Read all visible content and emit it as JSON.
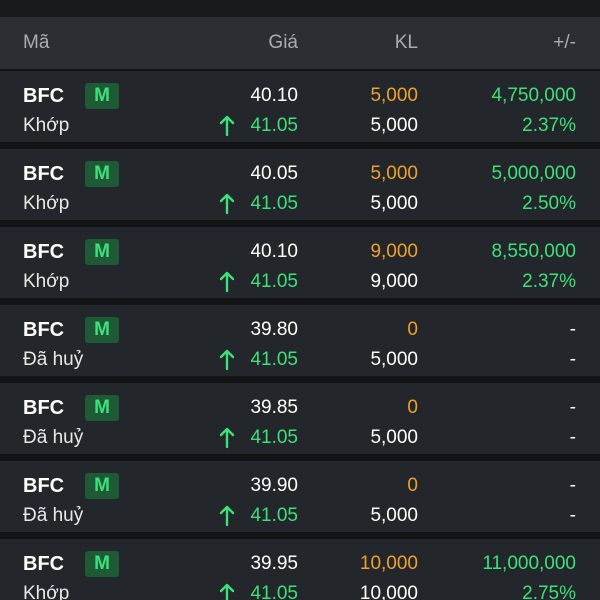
{
  "header": {
    "col_symbol": "Mã",
    "col_price": "Giá",
    "col_volume": "KL",
    "col_change": "+/-"
  },
  "colors": {
    "accent_green": "#3ee07a",
    "accent_orange": "#f0a12a",
    "badge_bg": "#1f5a37",
    "row_bg": "#23272b",
    "header_bg": "#2b2f33",
    "page_bg": "#121416"
  },
  "icons": {
    "up_arrow": "arrow-up-icon"
  },
  "rows": [
    {
      "symbol": "BFC",
      "badge": "M",
      "status": "Khớp",
      "price": "40.10",
      "ref_price": "41.05",
      "order_volume": "5,000",
      "matched_volume": "5,000",
      "value": "4,750,000",
      "percent": "2.37%"
    },
    {
      "symbol": "BFC",
      "badge": "M",
      "status": "Khớp",
      "price": "40.05",
      "ref_price": "41.05",
      "order_volume": "5,000",
      "matched_volume": "5,000",
      "value": "5,000,000",
      "percent": "2.50%"
    },
    {
      "symbol": "BFC",
      "badge": "M",
      "status": "Khớp",
      "price": "40.10",
      "ref_price": "41.05",
      "order_volume": "9,000",
      "matched_volume": "9,000",
      "value": "8,550,000",
      "percent": "2.37%"
    },
    {
      "symbol": "BFC",
      "badge": "M",
      "status": "Đã huỷ",
      "price": "39.80",
      "ref_price": "41.05",
      "order_volume": "0",
      "matched_volume": "5,000",
      "value": "-",
      "percent": "-"
    },
    {
      "symbol": "BFC",
      "badge": "M",
      "status": "Đã huỷ",
      "price": "39.85",
      "ref_price": "41.05",
      "order_volume": "0",
      "matched_volume": "5,000",
      "value": "-",
      "percent": "-"
    },
    {
      "symbol": "BFC",
      "badge": "M",
      "status": "Đã huỷ",
      "price": "39.90",
      "ref_price": "41.05",
      "order_volume": "0",
      "matched_volume": "5,000",
      "value": "-",
      "percent": "-"
    },
    {
      "symbol": "BFC",
      "badge": "M",
      "status": "Khớp",
      "price": "39.95",
      "ref_price": "41.05",
      "order_volume": "10,000",
      "matched_volume": "10,000",
      "value": "11,000,000",
      "percent": "2.75%"
    }
  ]
}
